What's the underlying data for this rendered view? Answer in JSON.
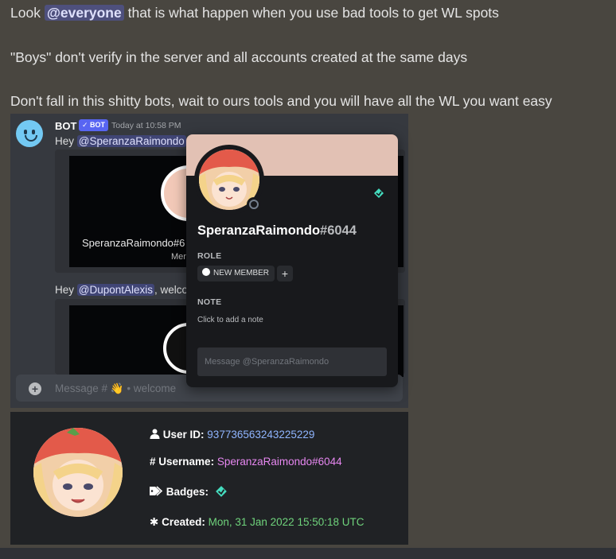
{
  "message": {
    "line1_prefix": "Look ",
    "line1_mention": "@everyone",
    "line1_suffix": " that is what happen when you use bad tools to get WL spots",
    "line2": "\"Boys\" don't verify in the server and all accounts created at the same days",
    "line3": "Don't fall in this shitty bots, wait to ours tools and you will have all the WL you want easy"
  },
  "discord_shot": {
    "bot_name": "BOT",
    "bot_badge": "✓ BOT",
    "timestamp": "Today at 10:58 PM",
    "greeting1_prefix": "Hey ",
    "greeting1_mention": "@SperanzaRaimondo",
    "greeting1_suffix": ",",
    "embed1_name": "SperanzaRaimondo#6",
    "embed1_sub": "Mer",
    "greeting2_prefix": "Hey ",
    "greeting2_mention": "@DupontAlexis",
    "greeting2_suffix": ", welco",
    "input_placeholder": "Message # 👋 • welcome"
  },
  "popout": {
    "username": "SperanzaRaimondo",
    "discriminator": "#6044",
    "role_header": "ROLE",
    "role_name": "NEW MEMBER",
    "role_add": "+",
    "note_header": "NOTE",
    "note_placeholder": "Click to add a note",
    "message_placeholder": "Message @SperanzaRaimondo",
    "colors": {
      "banner": "#e2c1b4",
      "hype_badge": "#44ddbf"
    }
  },
  "userinfo": {
    "user_id_label": "User ID:",
    "user_id": "937736563243225229",
    "username_label": "Username:",
    "username": "SperanzaRaimondo#6044",
    "badges_label": "Badges:",
    "created_label": "Created:",
    "created": "Mon, 31 Jan 2022 15:50:18 UTC",
    "icons": [
      "user-icon",
      "hash-icon",
      "tags-icon",
      "asterisk-icon",
      "hypesquad-badge-icon"
    ]
  }
}
